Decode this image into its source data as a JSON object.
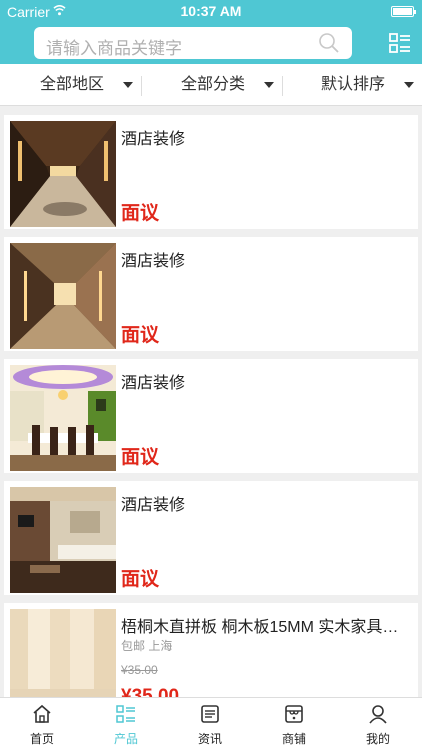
{
  "status_bar": {
    "carrier": "Carrier",
    "time": "10:37 AM"
  },
  "search": {
    "placeholder": "请输入商品关键字"
  },
  "filters": [
    {
      "label": "全部地区"
    },
    {
      "label": "全部分类"
    },
    {
      "label": "默认排序"
    }
  ],
  "products": [
    {
      "title": "酒店装修",
      "price": "面议",
      "image": "hotel-corridor-photo"
    },
    {
      "title": "酒店装修",
      "price": "面议",
      "image": "hotel-hallway-photo"
    },
    {
      "title": "酒店装修",
      "price": "面议",
      "image": "hotel-dining-room-photo"
    },
    {
      "title": "酒店装修",
      "price": "面议",
      "image": "hotel-room-photo"
    },
    {
      "title": "梧桐木直拼板 桐木板15MM 实木家具板 ...",
      "shipping": "包邮",
      "location": "上海",
      "old_price": "¥35.00",
      "price": "¥35.00",
      "image": "wood-board-photo"
    }
  ],
  "tabs": [
    {
      "label": "首页",
      "icon": "home-icon"
    },
    {
      "label": "产品",
      "icon": "grid-list-icon",
      "active": true
    },
    {
      "label": "资讯",
      "icon": "news-icon"
    },
    {
      "label": "商铺",
      "icon": "shop-icon"
    },
    {
      "label": "我的",
      "icon": "user-icon"
    }
  ],
  "colors": {
    "accent": "#4fc7d3",
    "price": "#e0271a"
  }
}
